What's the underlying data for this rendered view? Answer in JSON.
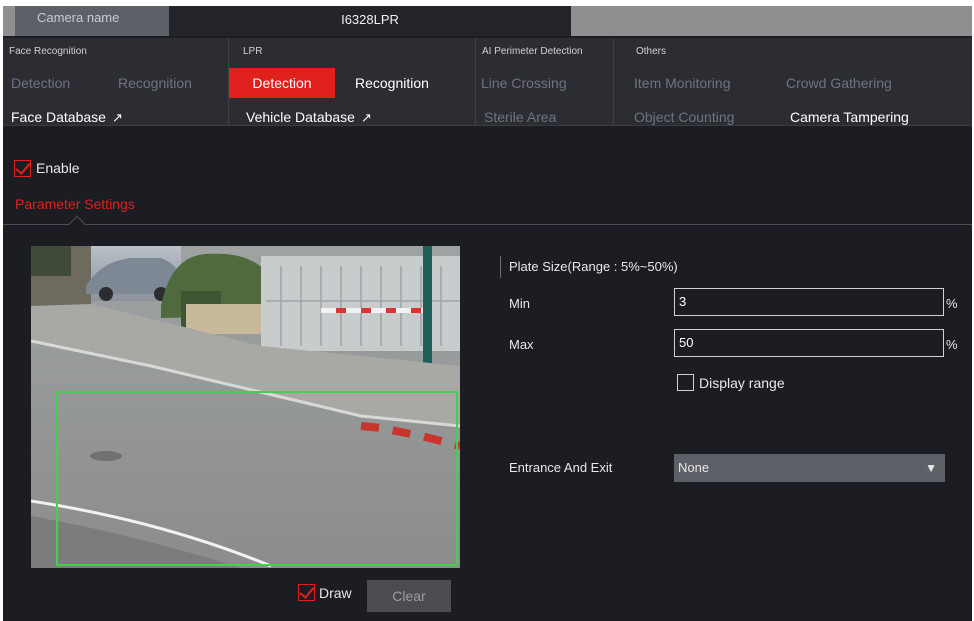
{
  "camera": {
    "label": "Camera name",
    "selected": "I6328LPR"
  },
  "groups": [
    {
      "title": "Face Recognition",
      "tabs": [
        {
          "label": "Detection"
        },
        {
          "label": "Recognition"
        }
      ],
      "link": "Face Database"
    },
    {
      "title": "LPR",
      "tabs": [
        {
          "label": "Detection"
        },
        {
          "label": "Recognition"
        }
      ],
      "link": "Vehicle Database"
    },
    {
      "title": "AI Perimeter Detection",
      "tabs": [
        {
          "label": "Line Crossing"
        },
        {
          "label": "Sterile Area"
        }
      ]
    },
    {
      "title": "Others",
      "tabs": [
        {
          "label": "Item Monitoring"
        },
        {
          "label": "Crowd Gathering"
        },
        {
          "label": "Object Counting"
        },
        {
          "label": "Camera Tampering"
        }
      ]
    }
  ],
  "enable": {
    "label": "Enable",
    "checked": true
  },
  "param_tab": "Parameter Settings",
  "plate_size": {
    "title": "Plate Size(Range : 5%~50%)",
    "min_label": "Min",
    "min_value": "3",
    "max_label": "Max",
    "max_value": "50",
    "unit": "%"
  },
  "display_range": {
    "label": "Display range",
    "checked": false
  },
  "entrance": {
    "label": "Entrance And Exit",
    "value": "None"
  },
  "draw": {
    "label": "Draw",
    "checked": true
  },
  "clear_label": "Clear",
  "colors": {
    "accent": "#e0201c",
    "detect_box": "#44d04a"
  }
}
